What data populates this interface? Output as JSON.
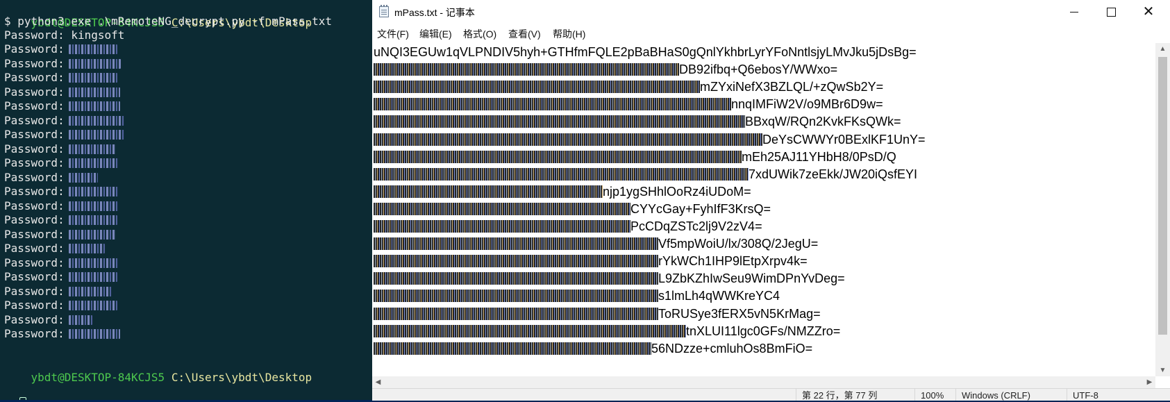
{
  "terminal": {
    "prompt_user": "ybdt@DESKTOP-84KCJS5",
    "prompt_path": "C:\\Users\\ybdt\\Desktop",
    "command": "$ python3.exe .\\mRemoteNG_decrypt.py -f mPass.txt",
    "password_label": "Password:",
    "first_password": "kingsoft",
    "bottom_prompt_user": "ybdt@DESKTOP-84KCJS5",
    "bottom_prompt_path": "C:\\Users\\ybdt\\Desktop",
    "colors": {
      "background": "#0c2a33",
      "user": "#4ec94e",
      "path": "#e8e6a0",
      "text": "#e8e8e8"
    }
  },
  "notepad": {
    "title": "mPass.txt - 记事本",
    "menu": [
      "文件(F)",
      "编辑(E)",
      "格式(O)",
      "查看(V)",
      "帮助(H)"
    ],
    "lines": [
      {
        "a": "",
        "b": "uNQI3EGUw1qVLPNDIV5hyh+GTHfmFQLE2pBaBHaS0gQnlYkhbrLyrYFoNntlsjyLMvJku5jDsBg="
      },
      {
        "a": "",
        "b": "DB92ifbq+Q6ebosY/WWxo="
      },
      {
        "a": "",
        "b": "mZYxiNefX3BZLQL/+zQwSb2Y="
      },
      {
        "a": "",
        "b": "nnqIMFiW2V/o9MBr6D9w="
      },
      {
        "a": "",
        "b": "BBxqW/RQn2KvkFKsQWk="
      },
      {
        "a": "",
        "b": "DeYsCWWYr0BExlKF1UnY="
      },
      {
        "a": "",
        "b": "mEh25AJ11YHbH8/0PsD/Q"
      },
      {
        "a": "",
        "b": "7xdUWik7zeEkk/JW20iQsfEYI"
      },
      {
        "a": "",
        "b": "njp1ygSHhlOoRz4iUDoM="
      },
      {
        "a": "",
        "b": "CYYcGay+FyhIfF3KrsQ="
      },
      {
        "a": "",
        "b": "PcCDqZSTc2lj9V2zV4="
      },
      {
        "a": "",
        "b": "Vf5mpWoiU/lx/308Q/2JegU="
      },
      {
        "a": "",
        "b": "rYkWCh1IHP9lEtpXrpv4k="
      },
      {
        "a": "",
        "b": "L9ZbKZhIwSeu9WimDPnYvDeg="
      },
      {
        "a": "",
        "b": "s1lmLh4qWWKreYC4"
      },
      {
        "a": "",
        "b": "ToRUSye3fERX5vN5KrMag="
      },
      {
        "a": "",
        "b": "tnXLUI11lgc0GFs/NMZZro="
      },
      {
        "a": "",
        "b": "56NDzze+cmluhOs8BmFiO="
      }
    ],
    "status": {
      "position": "第 22 行，第 77 列",
      "zoom": "100%",
      "eol": "Windows (CRLF)",
      "encoding": "UTF-8"
    }
  }
}
